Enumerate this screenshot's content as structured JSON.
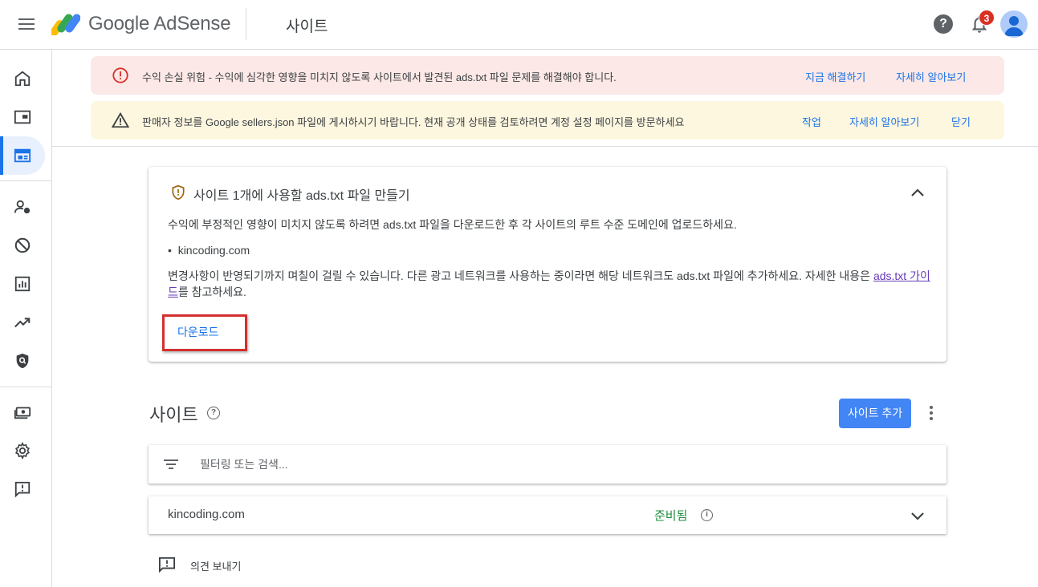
{
  "header": {
    "brand_google": "Google",
    "brand_product": "AdSense",
    "page_title": "사이트",
    "notification_count": "3",
    "help_label": "?"
  },
  "rail": {
    "items": [
      {
        "name": "home",
        "icon": "home-icon"
      },
      {
        "name": "ads",
        "icon": "ads-icon"
      },
      {
        "name": "sites",
        "icon": "sites-icon",
        "active": true
      },
      {
        "name": "privacy-messaging",
        "icon": "person-settings-icon"
      },
      {
        "name": "blocking-controls",
        "icon": "block-icon"
      },
      {
        "name": "reports",
        "icon": "bar-chart-icon"
      },
      {
        "name": "optimization",
        "icon": "trending-up-icon"
      },
      {
        "name": "policy-center",
        "icon": "shield-search-icon"
      },
      {
        "name": "payments",
        "icon": "payments-icon"
      },
      {
        "name": "account",
        "icon": "gear-icon"
      },
      {
        "name": "feedback",
        "icon": "feedback-icon"
      }
    ]
  },
  "banners": {
    "error": {
      "text": "수익 손실 위험 - 수익에 심각한 영향을 미치지 않도록 사이트에서 발견된 ads.txt 파일 문제를 해결해야 합니다.",
      "fix_now": "지금 해결하기",
      "learn_more": "자세히 알아보기"
    },
    "warning": {
      "text": "판매자 정보를 Google sellers.json 파일에 게시하시기 바랍니다. 현재 공개 상태를 검토하려면 계정 설정 페이지를 방문하세요",
      "action": "작업",
      "learn_more": "자세히 알아보기",
      "dismiss": "닫기"
    }
  },
  "ads_txt_card": {
    "title": "사이트 1개에 사용할 ads.txt 파일 만들기",
    "description": "수익에 부정적인 영향이 미치지 않도록 하려면 ads.txt 파일을 다운로드한 후 각 사이트의 루트 수준 도메인에 업로드하세요.",
    "sites": [
      "kincoding.com"
    ],
    "note_before": "변경사항이 반영되기까지 며칠이 걸릴 수 있습니다. 다른 광고 네트워크를 사용하는 중이라면 해당 네트워크도 ads.txt 파일에 추가하세요. 자세한 내용은 ",
    "guide_link": "ads.txt 가이드",
    "note_after": "를 참고하세요.",
    "download_label": "다운로드"
  },
  "sites_section": {
    "title": "사이트",
    "add_site_label": "사이트 추가",
    "filter_placeholder": "필터링 또는 검색...",
    "rows": [
      {
        "domain": "kincoding.com",
        "status": "준비됨"
      }
    ]
  },
  "feedback": {
    "label": "의견 보내기"
  },
  "colors": {
    "accent": "#1a73e8",
    "primary_button": "#4285f4",
    "error_banner": "#fce8e6",
    "warning_banner": "#fef7e0",
    "status_ready": "#1e8e3e",
    "highlight": "#d32f2f"
  }
}
